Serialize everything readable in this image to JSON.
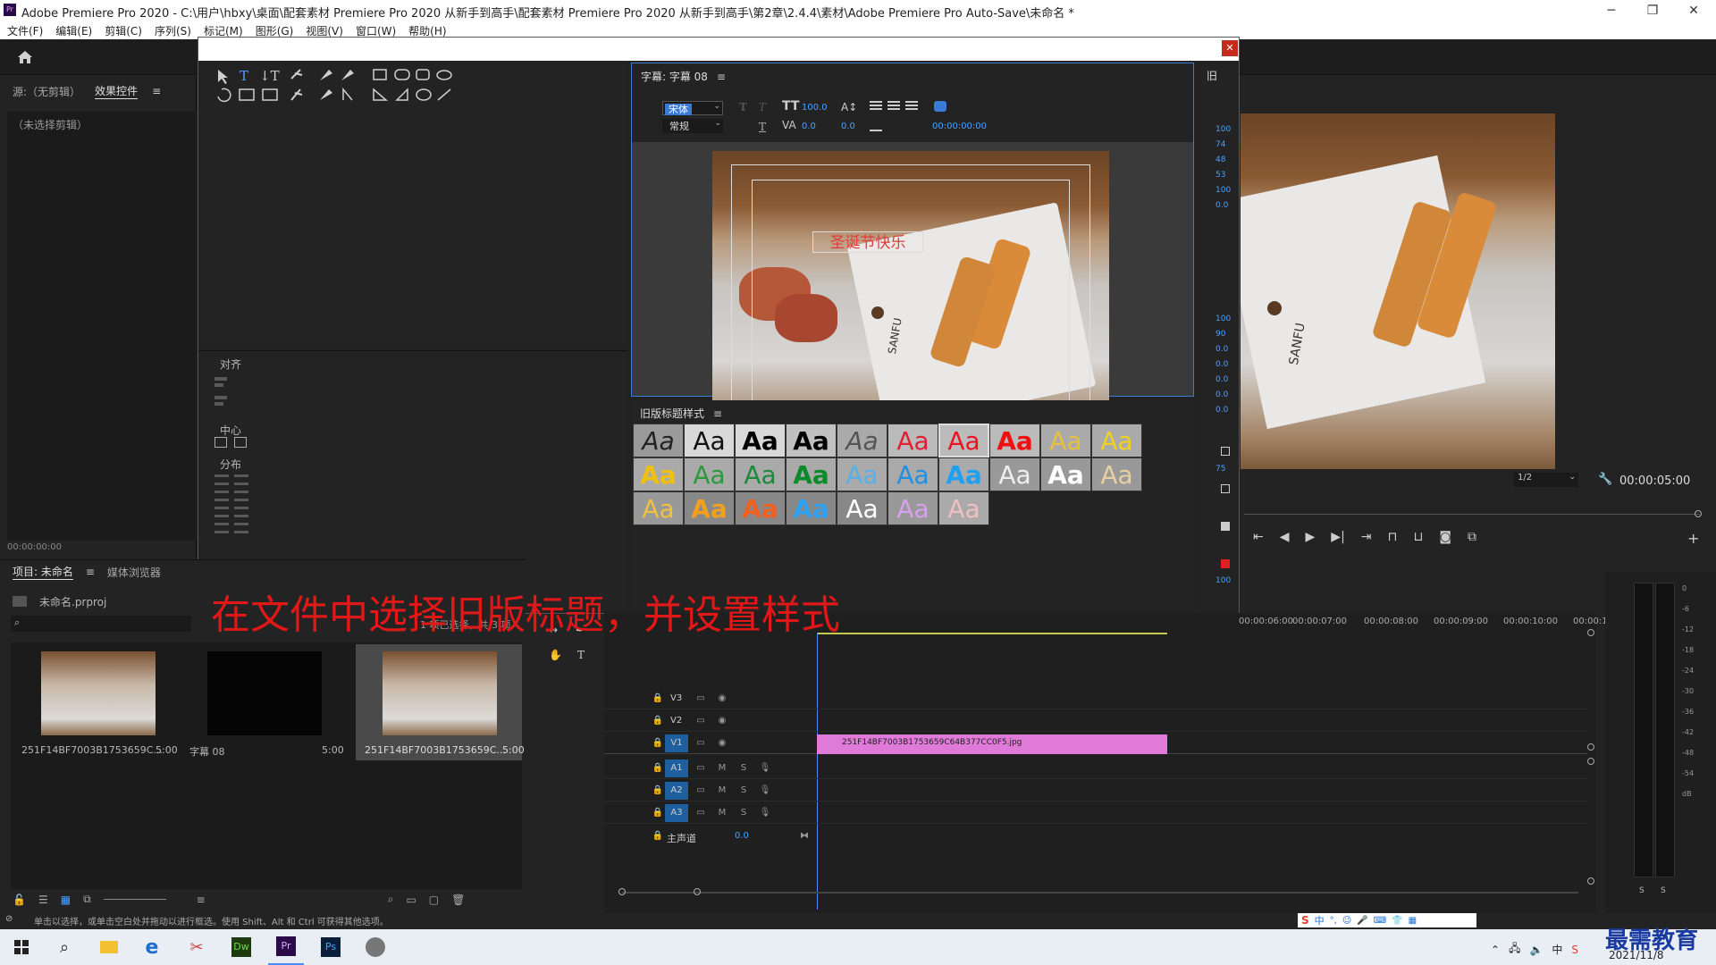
{
  "window": {
    "title": "Adobe Premiere Pro 2020 - C:\\用户\\hbxy\\桌面\\配套素材 Premiere Pro 2020 从新手到高手\\配套素材 Premiere Pro 2020 从新手到高手\\第2章\\2.4.4\\素材\\Adobe Premiere Pro Auto-Save\\未命名 *"
  },
  "menu": [
    "文件(F)",
    "编辑(E)",
    "剪辑(C)",
    "序列(S)",
    "标记(M)",
    "图形(G)",
    "视图(V)",
    "窗口(W)",
    "帮助(H)"
  ],
  "source_panel": {
    "tabs": [
      "源:（无剪辑）",
      "效果控件"
    ],
    "no_clip": "（未选择剪辑）",
    "timecode": "00:00:00:00"
  },
  "title_dialog": {
    "panel_title": "字幕: 字幕 08",
    "font_family": "宋体",
    "font_style": "常规",
    "font_size": "100.0",
    "kerning": "0.0",
    "leading": "0.0",
    "timecode": "00:00:00:00",
    "sample_text": "圣诞节快乐",
    "sanfu_text": "SANFU",
    "align_label": "对齐",
    "center_label": "中心",
    "distribute_label": "分布",
    "styles_title": "旧版标题样式",
    "right_panel_label": "旧",
    "right_values": [
      "100",
      "74",
      "48",
      "53",
      "100",
      "0.0",
      "100",
      "90",
      "0.0",
      "0.0",
      "0.0",
      "0.0",
      "0.0",
      "75",
      "100"
    ]
  },
  "program_monitor": {
    "scale": "1/2",
    "timecode": "00:00:05:00"
  },
  "project_panel": {
    "tabs": [
      "项目: 未命名",
      "媒体浏览器"
    ],
    "project_file": "未命名.prproj",
    "status": "1 项已选择，共 3 项",
    "items": [
      {
        "name": "251F14BF7003B1753659C...",
        "duration": "5:00"
      },
      {
        "name": "字幕 08",
        "duration": "5:00"
      },
      {
        "name": "251F14BF7003B1753659C...",
        "duration": "5:00"
      }
    ]
  },
  "timeline": {
    "ruler": [
      "00:00:06:00",
      "00:00:07:00",
      "00:00:08:00",
      "00:00:09:00",
      "00:00:10:00",
      "00:00:1"
    ],
    "video_tracks": [
      "V3",
      "V2",
      "V1"
    ],
    "audio_tracks": [
      "A1",
      "A2",
      "A3"
    ],
    "master_label": "主声道",
    "master_value": "0.0",
    "clip_name": "251F14BF7003B1753659C64B377CC0F5.jpg",
    "track_m": "M",
    "track_s": "S"
  },
  "meter": {
    "scale": [
      "0",
      "-6",
      "-12",
      "-18",
      "-24",
      "-30",
      "-36",
      "-42",
      "-48",
      "-54",
      "dB"
    ],
    "solo": [
      "S",
      "S"
    ]
  },
  "overlay_caption": "在文件中选择旧版标题，并设置样式",
  "status_bar": {
    "text": "单击以选择，或单击空白处并拖动以进行框选。使用 Shift、Alt 和 Ctrl 可获得其他选项。"
  },
  "taskbar": {
    "ime": "中",
    "date": "2021/11/8",
    "watermark": "最需教育"
  },
  "colors": {
    "accent": "#2d8ceb",
    "clip_pink": "#e07ad8",
    "overlay_red": "#e01818",
    "playhead": "#4a8cff"
  }
}
